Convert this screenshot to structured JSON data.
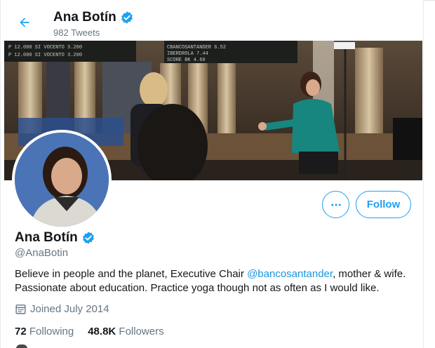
{
  "header": {
    "back_icon": "arrow-left-icon",
    "name": "Ana Botín",
    "tweets_count": "982 Tweets"
  },
  "banner": {
    "description_icon": "interview-photo",
    "ticker_lines": [
      "P 12.000",
      "SI VOCENTO",
      "3.200",
      "CBANCOSANTANDER",
      "IBERDROLA",
      "SCORE",
      "BK"
    ]
  },
  "profile": {
    "name": "Ana Botín",
    "handle": "@AnaBotin",
    "bio_before": "Believe in people and the planet, Executive Chair ",
    "bio_mention": "@bancosantander",
    "bio_after": ", mother & wife. Passionate about education. Practice yoga though not as often as I would like.",
    "joined": "Joined July 2014",
    "following_count": "72",
    "following_label": " Following",
    "followers_count": "48.8K",
    "followers_label": " Followers"
  },
  "actions": {
    "more_icon": "more-horizontal-icon",
    "follow_label": "Follow"
  },
  "colors": {
    "accent": "#1da1f2",
    "verified": "#1da1f2",
    "secondary_text": "#657786"
  }
}
